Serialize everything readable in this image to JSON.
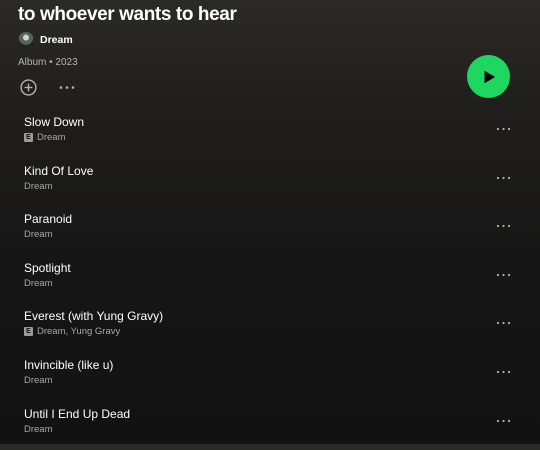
{
  "album": {
    "title": "to whoever wants to hear",
    "artist": "Dream",
    "meta": "Album • 2023"
  },
  "icons": {
    "add": "add-circle-icon",
    "more": "more-horizontal-icon",
    "play": "play-icon",
    "avatar": "artist-avatar"
  },
  "colors": {
    "play_button": "#1ed760",
    "background": "#121212",
    "secondary_text": "#b3b3b3"
  },
  "tracks": [
    {
      "title": "Slow Down",
      "artist": "Dream",
      "explicit": true
    },
    {
      "title": "Kind Of Love",
      "artist": "Dream",
      "explicit": false
    },
    {
      "title": "Paranoid",
      "artist": "Dream",
      "explicit": false
    },
    {
      "title": "Spotlight",
      "artist": "Dream",
      "explicit": false
    },
    {
      "title": "Everest (with Yung Gravy)",
      "artist": "Dream, Yung Gravy",
      "explicit": true
    },
    {
      "title": "Invincible (like u)",
      "artist": "Dream",
      "explicit": false
    },
    {
      "title": "Until I End Up Dead",
      "artist": "Dream",
      "explicit": false
    }
  ],
  "explicit_label": "E"
}
